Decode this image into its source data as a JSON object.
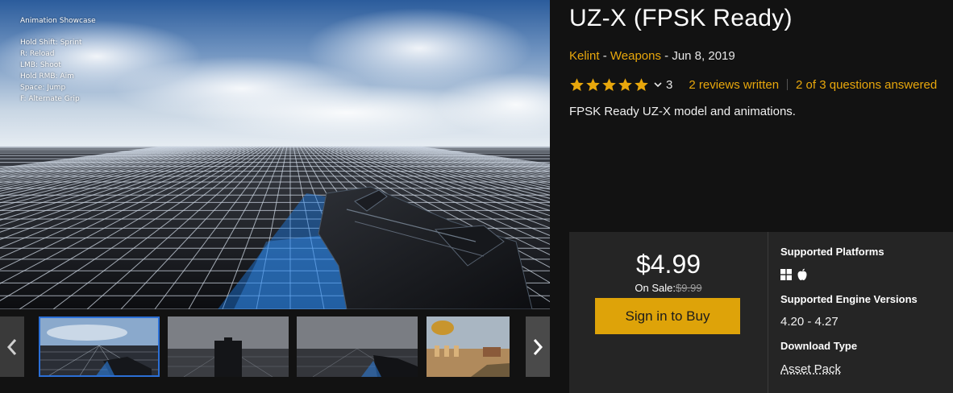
{
  "preview": {
    "overlay_title": "Animation Showcase",
    "overlay_lines": [
      "Hold Shift: Sprint",
      "R: Reload",
      "LMB: Shoot",
      "Hold RMB: Aim",
      "Space: Jump",
      "F: Alternate Grip"
    ]
  },
  "gallery": {
    "prev_icon": "chevron-left-icon",
    "next_icon": "chevron-right-icon",
    "active_index": 0
  },
  "product": {
    "title": "UZ-X (FPSK Ready)",
    "seller": "Kelint",
    "separator": " - ",
    "category": "Weapons",
    "date": "Jun 8, 2019",
    "rating_stars": 5,
    "rating_count": "3",
    "reviews_link": "2 reviews written",
    "questions_link": "2 of 3 questions answered",
    "description": "FPSK Ready UZ-X model and animations."
  },
  "purchase": {
    "price": "$4.99",
    "sale_label": "On Sale:",
    "old_price": "$9.99",
    "buy_label": "Sign in to Buy"
  },
  "specs": {
    "platforms_label": "Supported Platforms",
    "platform_icons": [
      "windows-icon",
      "apple-icon"
    ],
    "engine_label": "Supported Engine Versions",
    "engine_value": "4.20 - 4.27",
    "download_label": "Download Type",
    "download_value": "Asset Pack"
  },
  "colors": {
    "accent": "#e8a70c",
    "button": "#dea309",
    "panel": "#252525",
    "background": "#121212"
  }
}
